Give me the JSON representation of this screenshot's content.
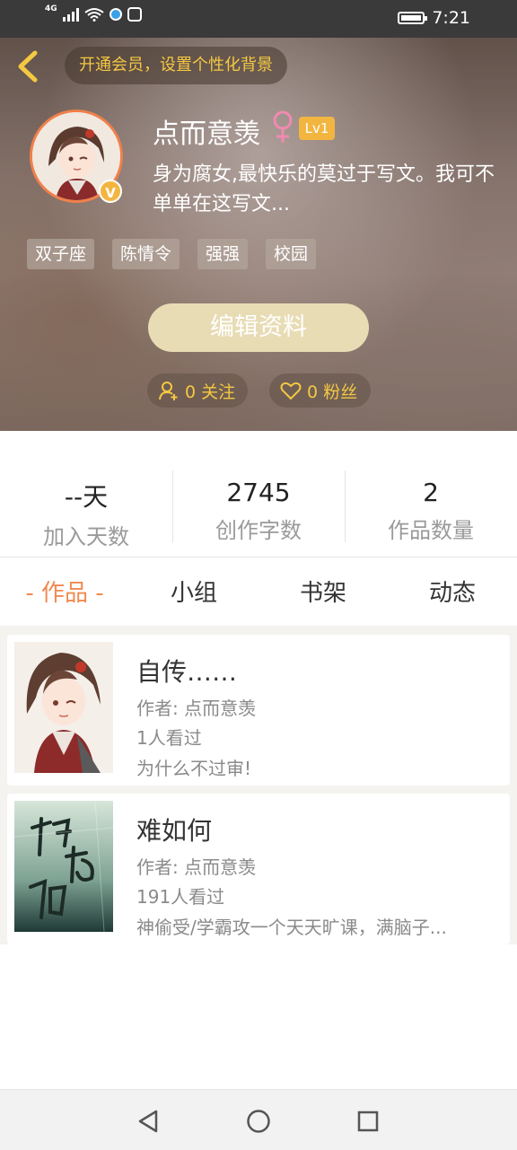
{
  "status_bar": {
    "network": "4G",
    "time": "7:21"
  },
  "header": {
    "vip_banner": "开通会员，设置个性化背景",
    "user_name": "点而意羡",
    "level": "Lv1",
    "verified_badge": "V",
    "bio": "身为腐女,最快乐的莫过于写文。我可不单单在这写文...",
    "tags": [
      "双子座",
      "陈情令",
      "强强",
      "校园"
    ],
    "edit_button": "编辑资料",
    "follow": "0 关注",
    "fans": "0 粉丝"
  },
  "stats": [
    {
      "value": "--天",
      "label": "加入天数"
    },
    {
      "value": "2745",
      "label": "创作字数"
    },
    {
      "value": "2",
      "label": "作品数量"
    }
  ],
  "tabs": [
    {
      "label": "- 作品 -",
      "active": true
    },
    {
      "label": "小组",
      "active": false
    },
    {
      "label": "书架",
      "active": false
    },
    {
      "label": "动态",
      "active": false
    }
  ],
  "works": [
    {
      "title": "自传……",
      "author": "作者: 点而意羡",
      "views": "1人看过",
      "note": "为什么不过审!"
    },
    {
      "title": "难如何",
      "author": "作者: 点而意羡",
      "views": "191人看过",
      "note": "神偷受/学霸攻一个天天旷课，满脑子..."
    }
  ],
  "colors": {
    "accent": "#f08a50",
    "gold": "#f5c842",
    "badge": "#f2b640"
  }
}
